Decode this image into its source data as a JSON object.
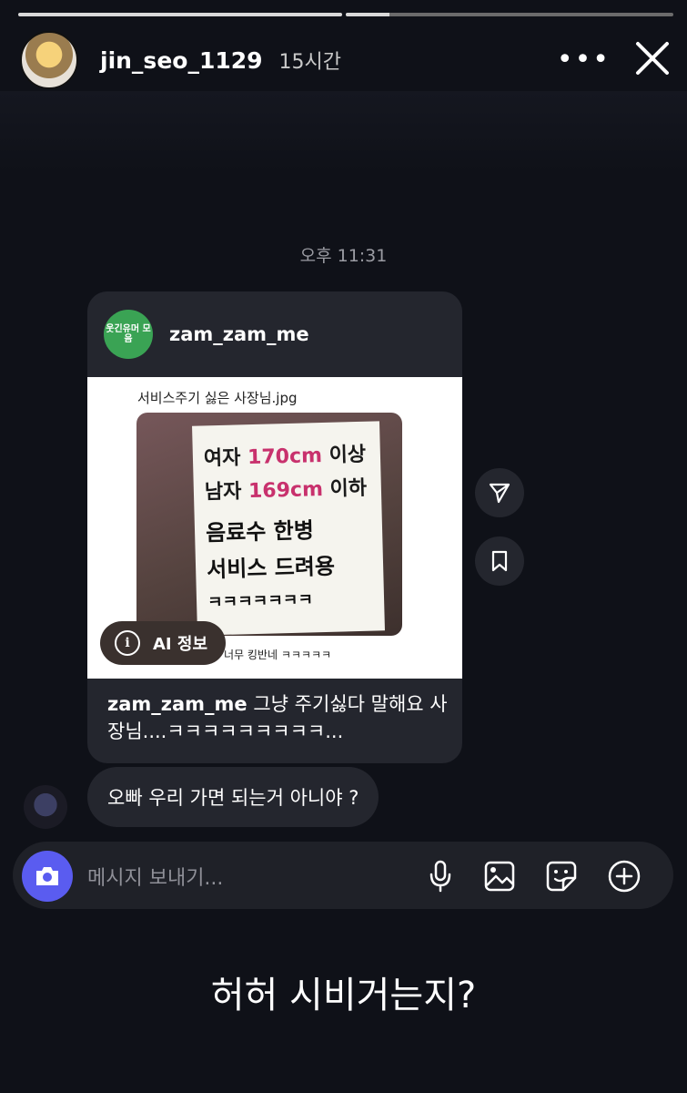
{
  "story": {
    "progress_segments": 2,
    "username": "jin_seo_1129",
    "time_ago": "15시간"
  },
  "chat": {
    "timestamp": "오후 11:31",
    "shared_post": {
      "username": "zam_zam_me",
      "avatar_text": "웃긴유머 모음",
      "title": "서비스주기 싫은 사장님.jpg",
      "sign_lines": {
        "l1_a": "여자",
        "l1_b": "170cm",
        "l1_c": "이상",
        "l2_a": "남자",
        "l2_b": "169cm",
        "l2_c": "이하",
        "l3": "음료수 한병",
        "l4": "서비스 드려용",
        "l5": "ㅋㅋㅋㅋㅋㅋㅋ"
      },
      "small_caption": "너무 킹반네 ㅋㅋㅋㅋㅋ",
      "ai_label": "AI 정보",
      "caption_user": "zam_zam_me",
      "caption_text": " 그냥 주기싫다 말해요 사장님....ㅋㅋㅋㅋㅋㅋㅋㅋㅋ..."
    },
    "reply_message": "오빠 우리 가면 되는거 아니야 ?"
  },
  "composer": {
    "placeholder": "메시지 보내기..."
  },
  "story_caption": "허허 시비거는지?",
  "icons": {
    "more": "more-horizontal-icon",
    "close": "close-icon",
    "share": "send-icon",
    "save": "bookmark-icon",
    "camera": "camera-icon",
    "mic": "microphone-icon",
    "gallery": "image-icon",
    "sticker": "sticker-icon",
    "add": "plus-circle-icon"
  },
  "colors": {
    "background": "#0f1118",
    "bubble": "#24262e",
    "camera_button": "#5a5cf0",
    "sign_accent": "#c8316d"
  }
}
